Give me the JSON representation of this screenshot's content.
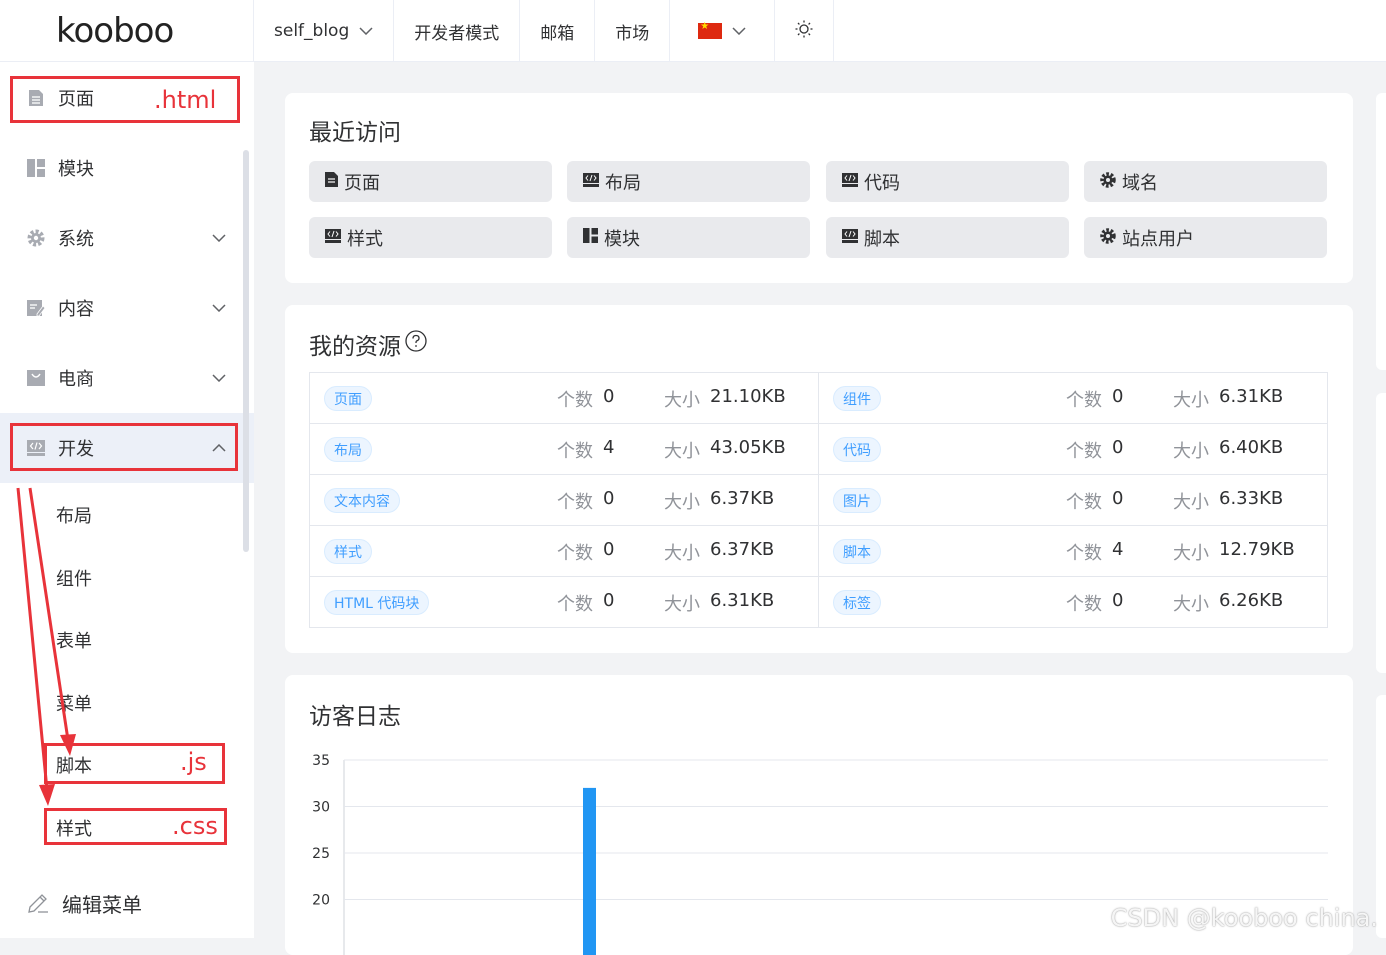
{
  "logo": "kooboo",
  "topnav": [
    {
      "label": "self_blog",
      "chevron": true
    },
    {
      "label": "开发者模式"
    },
    {
      "label": "邮箱"
    },
    {
      "label": "市场"
    },
    {
      "label": "",
      "flag": "china-flag",
      "chevron": true
    },
    {
      "label": "",
      "icon": "sun-icon"
    }
  ],
  "sidebar": {
    "items": [
      {
        "label": "页面",
        "icon": "page-icon"
      },
      {
        "label": "模块",
        "icon": "module-icon"
      },
      {
        "label": "系统",
        "icon": "gear-icon",
        "chevron": "down"
      },
      {
        "label": "内容",
        "icon": "content-icon",
        "chevron": "down"
      },
      {
        "label": "电商",
        "icon": "shop-icon",
        "chevron": "down"
      },
      {
        "label": "开发",
        "icon": "code-icon",
        "chevron": "up",
        "active": true
      }
    ],
    "sub_items": [
      "布局",
      "组件",
      "表单",
      "菜单",
      "脚本",
      "样式"
    ],
    "edit_menu": "编辑菜单"
  },
  "annotations": {
    "page": ".html",
    "script": ".js",
    "style": ".css"
  },
  "recent": {
    "title": "最近访问",
    "items": [
      {
        "label": "页面",
        "icon": "doc-icon"
      },
      {
        "label": "布局",
        "icon": "code-icon"
      },
      {
        "label": "代码",
        "icon": "code-icon"
      },
      {
        "label": "域名",
        "icon": "gear-icon"
      },
      {
        "label": "样式",
        "icon": "code-icon"
      },
      {
        "label": "模块",
        "icon": "module-icon"
      },
      {
        "label": "脚本",
        "icon": "code-icon"
      },
      {
        "label": "站点用户",
        "icon": "gear-icon"
      }
    ]
  },
  "resources": {
    "title": "我的资源",
    "count_label": "个数",
    "size_label": "大小",
    "rows": [
      [
        {
          "tag": "页面",
          "count": "0",
          "size": "21.10KB"
        },
        {
          "tag": "组件",
          "count": "0",
          "size": "6.31KB"
        }
      ],
      [
        {
          "tag": "布局",
          "count": "4",
          "size": "43.05KB"
        },
        {
          "tag": "代码",
          "count": "0",
          "size": "6.40KB"
        }
      ],
      [
        {
          "tag": "文本内容",
          "count": "0",
          "size": "6.37KB"
        },
        {
          "tag": "图片",
          "count": "0",
          "size": "6.33KB"
        }
      ],
      [
        {
          "tag": "样式",
          "count": "0",
          "size": "6.37KB"
        },
        {
          "tag": "脚本",
          "count": "4",
          "size": "12.79KB"
        }
      ],
      [
        {
          "tag": "HTML 代码块",
          "count": "0",
          "size": "6.31KB"
        },
        {
          "tag": "标签",
          "count": "0",
          "size": "6.26KB"
        }
      ]
    ]
  },
  "visitor_log": {
    "title": "访客日志"
  },
  "chart_data": {
    "type": "bar",
    "title": "",
    "yticks": [
      35,
      30,
      25,
      20
    ],
    "ylim_visible": [
      17,
      35
    ],
    "bars": [
      {
        "value": 32
      }
    ],
    "color": "#2196f3",
    "grid": true
  },
  "watermark": "CSDN @kooboo china."
}
